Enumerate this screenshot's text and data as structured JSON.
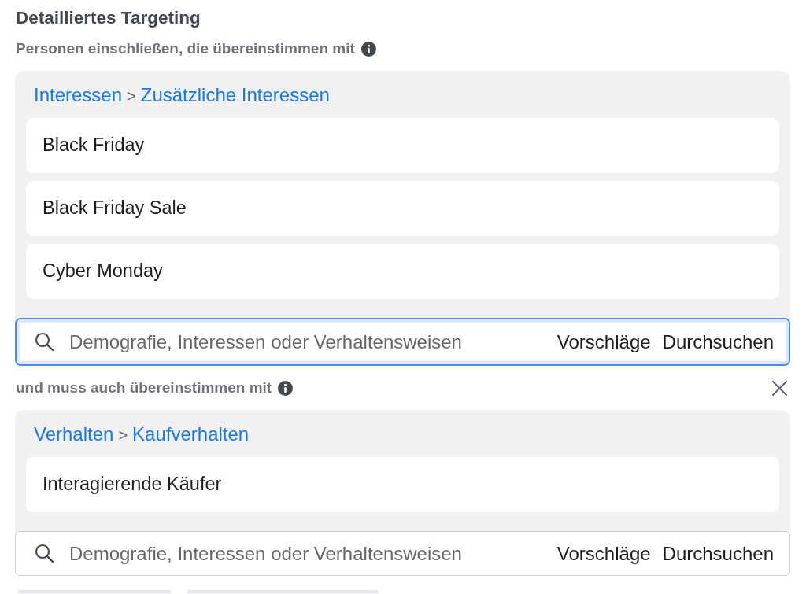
{
  "title": "Detailliertes Targeting",
  "groups": [
    {
      "label": "Personen einschließen, die übereinstimmen mit",
      "removable": false,
      "path": {
        "items": [
          "Interessen",
          "Zusätzliche Interessen"
        ],
        "separator": ">"
      },
      "items": [
        "Black Friday",
        "Black Friday Sale",
        "Cyber Monday"
      ],
      "search": {
        "placeholder": "Demografie, Interessen oder Verhaltensweisen",
        "focused": true,
        "actions": [
          "Vorschläge",
          "Durchsuchen"
        ]
      }
    },
    {
      "label": "und muss auch übereinstimmen mit",
      "removable": true,
      "path": {
        "items": [
          "Verhalten",
          "Kaufverhalten"
        ],
        "separator": ">"
      },
      "items": [
        "Interagierende Käufer"
      ],
      "search": {
        "placeholder": "Demografie, Interessen oder Verhaltensweisen",
        "focused": false,
        "actions": [
          "Vorschläge",
          "Durchsuchen"
        ]
      }
    }
  ]
}
